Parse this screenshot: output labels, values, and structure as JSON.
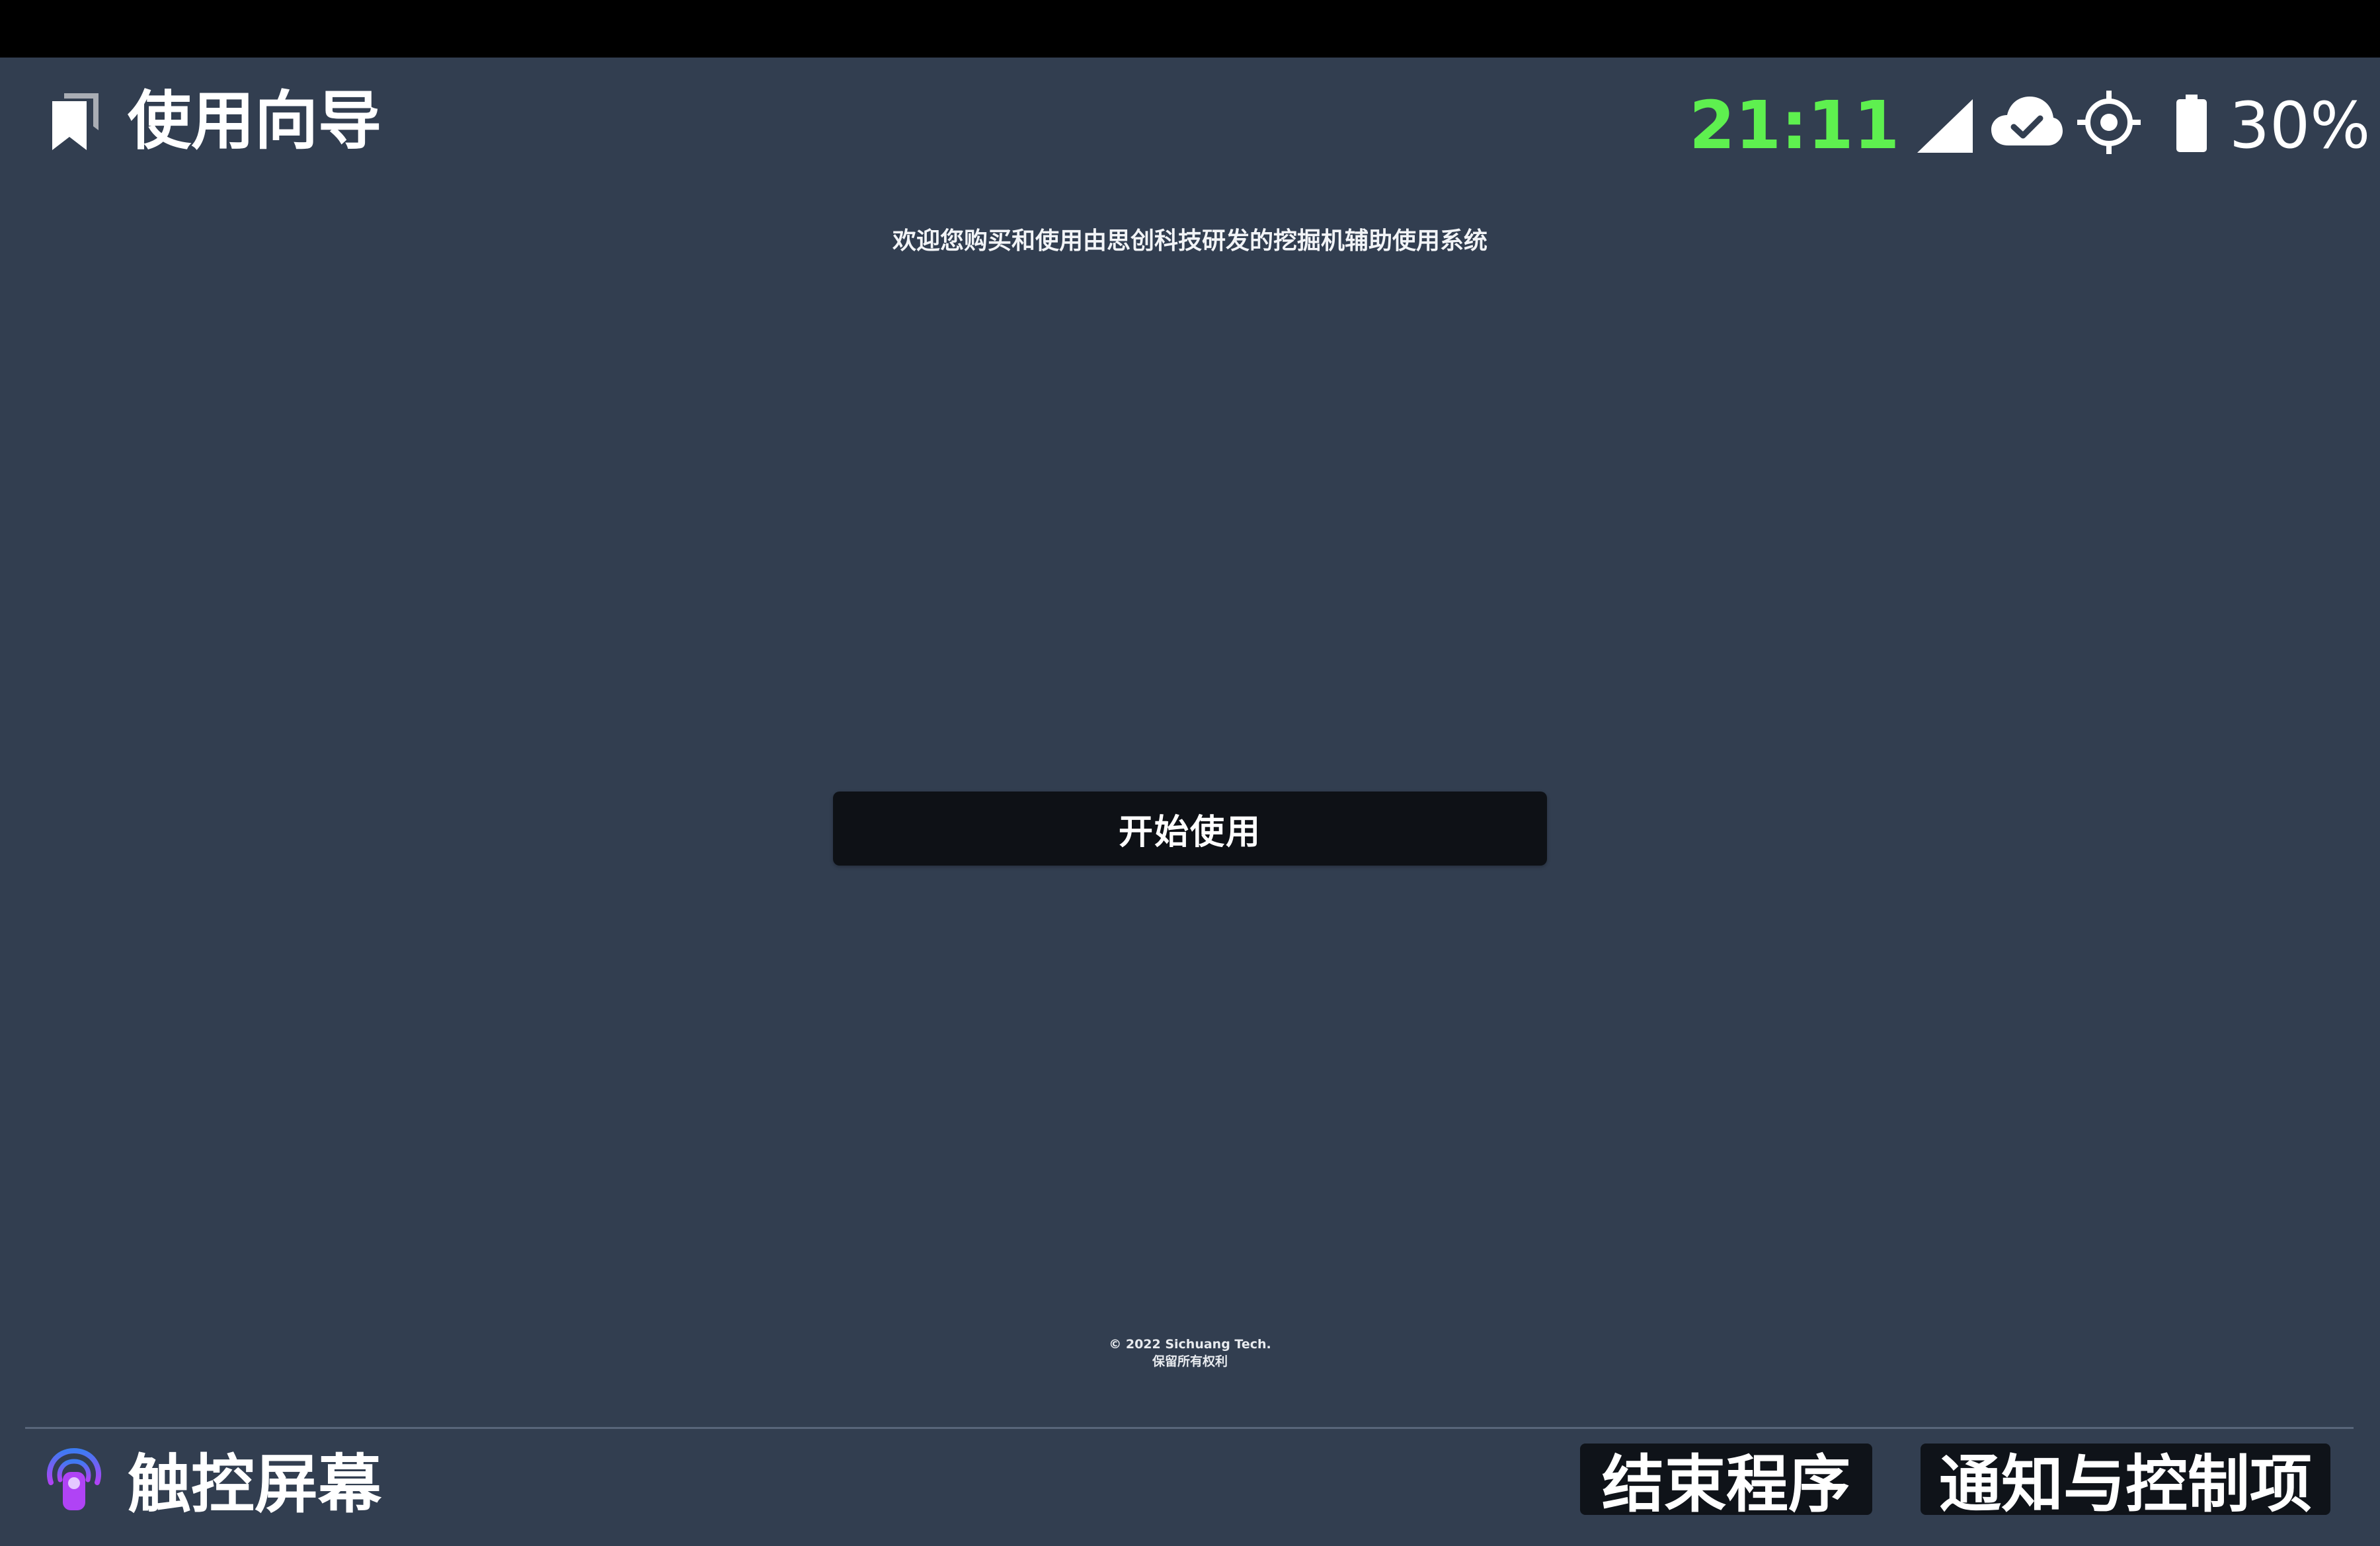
{
  "header": {
    "title": "使用向导",
    "app_icon": "bookmark-icon"
  },
  "status_bar": {
    "time": "21:11",
    "time_color": "#5ef04f",
    "icons": [
      "signal-icon",
      "cloud-done-icon",
      "gps-fixed-icon",
      "battery-icon"
    ],
    "battery": "30%"
  },
  "main": {
    "welcome_text": "欢迎您购买和使用由思创科技研发的挖掘机辅助使用系统",
    "start_button_label": "开始使用",
    "copyright_line1": "© 2022 Sichuang Tech.",
    "copyright_line2": "保留所有权利"
  },
  "bottom_bar": {
    "touch_label": "触控屏幕",
    "touch_icon": "touch-icon",
    "end_program_label": "结束程序",
    "notifications_label": "通知与控制项"
  },
  "colors": {
    "background": "#323e50",
    "button_background": "#0e1116",
    "accent_purple": "#b043f5",
    "accent_blue": "#3d7bf2"
  }
}
